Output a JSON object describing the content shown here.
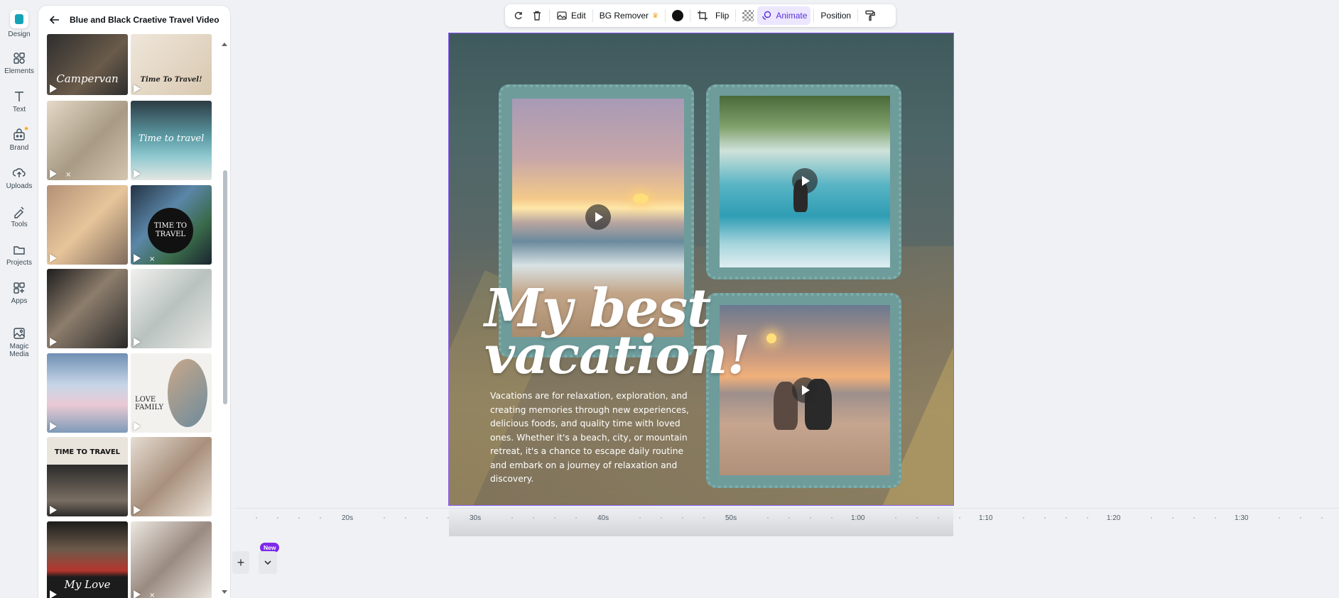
{
  "rail": {
    "items": [
      {
        "label": "Design",
        "icon": "design-icon"
      },
      {
        "label": "Elements",
        "icon": "elements-icon"
      },
      {
        "label": "Text",
        "icon": "text-icon"
      },
      {
        "label": "Brand",
        "icon": "brand-icon"
      },
      {
        "label": "Uploads",
        "icon": "uploads-icon"
      },
      {
        "label": "Tools",
        "icon": "tools-icon"
      },
      {
        "label": "Projects",
        "icon": "projects-icon"
      },
      {
        "label": "Apps",
        "icon": "apps-icon"
      },
      {
        "label": "Magic Media",
        "icon": "magic-media-icon"
      }
    ]
  },
  "panel": {
    "title": "Blue and Black Craetive Travel Video",
    "thumbs": [
      {
        "text": "Campervan",
        "bg": "#3a3a3a"
      },
      {
        "text": "Time To Travel!",
        "bg": "#efe6da"
      },
      {
        "text": "",
        "bg": "#d9ccb9"
      },
      {
        "text": "Time to travel",
        "bg": "#5d8c96"
      },
      {
        "text": "",
        "bg": "#b49077"
      },
      {
        "text": "TIME TO TRAVEL",
        "bg": "#243344"
      },
      {
        "text": "",
        "bg": "#2c2c2c"
      },
      {
        "text": "",
        "bg": "#e8e8e6"
      },
      {
        "text": "",
        "bg": "#7e9bb8"
      },
      {
        "text": "LOVE FAMILY",
        "bg": "#f2f1ee"
      },
      {
        "text": "TIME TO TRAVEL",
        "bg": "#e9e4dc"
      },
      {
        "text": "",
        "bg": "#e6ddd3"
      },
      {
        "text": "My Love",
        "bg": "#1c1c1c"
      },
      {
        "text": "",
        "bg": "#ece8e2"
      }
    ]
  },
  "toolbar": {
    "edit": "Edit",
    "bg_remover": "BG Remover",
    "flip": "Flip",
    "animate": "Animate",
    "position": "Position"
  },
  "canvas": {
    "headline": "My best vacation!",
    "body": "Vacations are for relaxation, exploration, and creating memories through new experiences, delicious foods, and quality time with loved ones. Whether it's a beach, city, or mountain retreat, it's a chance to escape daily routine and embark on a journey of relaxation and discovery."
  },
  "timeline": {
    "ticks": [
      "20s",
      "30s",
      "40s",
      "50s",
      "1:00",
      "1:10",
      "1:20",
      "1:30"
    ],
    "new_badge": "New",
    "add_symbol": "+"
  },
  "colors": {
    "accent": "#8b5cf6",
    "brand_teal": "#13a3b5",
    "frame_teal": "#6e9c9b",
    "animate_text": "#5a32d8"
  }
}
